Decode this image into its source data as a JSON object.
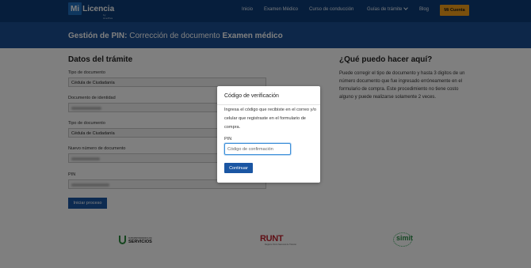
{
  "header": {
    "logo": {
      "mark": "Mi",
      "name": "Licencia",
      "tagline": "by AvePlus"
    },
    "nav": [
      {
        "label": "Inicio"
      },
      {
        "label": "Examen Médico"
      },
      {
        "label": "Curso de conducción"
      },
      {
        "label": "Guías de trámite"
      },
      {
        "label": "Blog"
      }
    ],
    "account_button": "Mi Cuenta"
  },
  "banner": {
    "prefix": "Gestión de PIN:",
    "middle": "Corrección de documento",
    "suffix": "Examen médico"
  },
  "form": {
    "title": "Datos del trámite",
    "fields": [
      {
        "label": "Tipo de documento",
        "value": "Cédula de Ciudadanía"
      },
      {
        "label": "Documento de identidad",
        "value": ""
      },
      {
        "label": "Tipo de documento",
        "value": "Cédula de Ciudadanía"
      },
      {
        "label": "Nuevo número de documento",
        "value": ""
      },
      {
        "label": "PIN",
        "value": ""
      }
    ],
    "submit": "Iniciar proceso"
  },
  "aside": {
    "title": "¿Qué puedo hacer aquí?",
    "text": "Puede corregir el tipo de documento y hasta 3 digitos de un número documento que fue ingresado erróneamente en el formulario de compra. Este procedimiento no tiene costo alguno y puede realizarse solamente 2 veces."
  },
  "partners": {
    "servicios": {
      "small": "SUPERINTENDENCIA DE",
      "name": "SERVICIOS"
    },
    "runt": {
      "name": "RUNT",
      "small": "Registro Único Nacional de Tránsito"
    },
    "simit": {
      "name": "simit"
    }
  },
  "modal": {
    "title": "Código de verificación",
    "text": "Ingresa el código que recibiste en el correo y/o celular que registraste en el formulario de compra.",
    "pin_label": "PIN",
    "input_placeholder": "Código de confirmación",
    "input_value": "",
    "button": "Continuar"
  },
  "colors": {
    "nav_bg": "#0c3d78",
    "banner_bg": "#1b4f92",
    "primary_button": "#1a56a3",
    "account_button": "#f4a11a",
    "runt_red": "#c0202d",
    "simit_green": "#2f8f4a"
  }
}
